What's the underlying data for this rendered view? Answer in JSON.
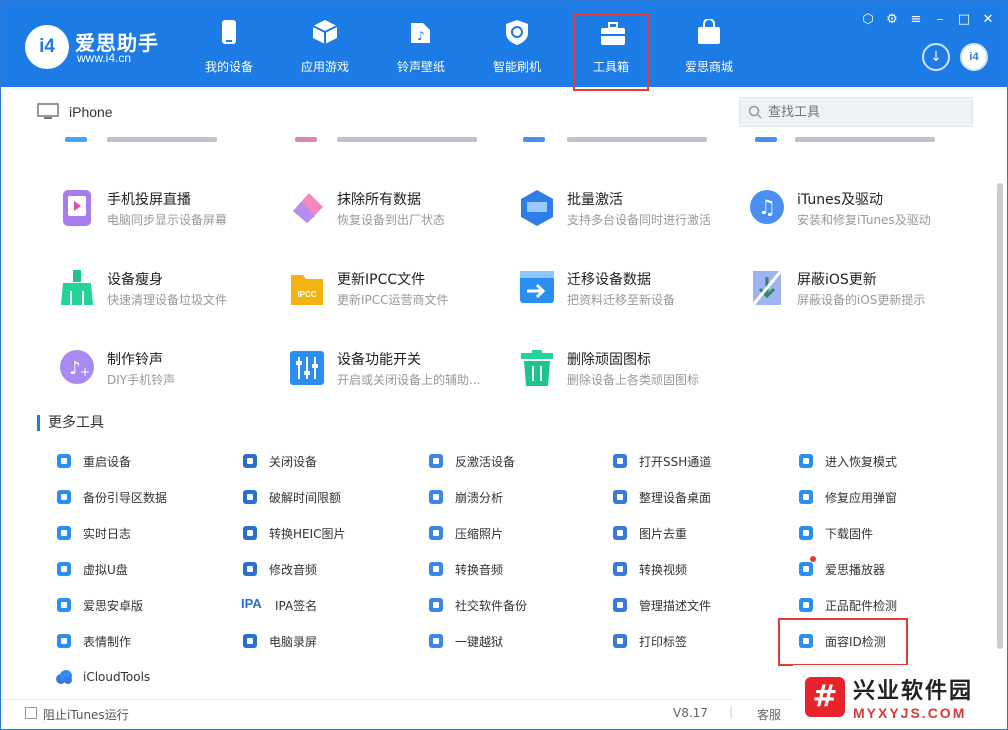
{
  "app": {
    "logo_text": "i4",
    "brand": "爱思助手",
    "url": "www.i4.cn"
  },
  "nav": [
    {
      "label": "我的设备",
      "icon": "phone-icon"
    },
    {
      "label": "应用游戏",
      "icon": "cube-icon"
    },
    {
      "label": "铃声壁纸",
      "icon": "music-file-icon"
    },
    {
      "label": "智能刷机",
      "icon": "refresh-shield-icon"
    },
    {
      "label": "工具箱",
      "icon": "toolbox-icon",
      "active": true
    },
    {
      "label": "爱思商城",
      "icon": "shopping-bag-icon"
    }
  ],
  "device": {
    "name": "iPhone"
  },
  "search": {
    "placeholder": "查找工具"
  },
  "tools": [
    {
      "title": "手机投屏直播",
      "desc": "电脑同步显示设备屏幕"
    },
    {
      "title": "抹除所有数据",
      "desc": "恢复设备到出厂状态"
    },
    {
      "title": "批量激活",
      "desc": "支持多台设备同时进行激活"
    },
    {
      "title": "iTunes及驱动",
      "desc": "安装和修复iTunes及驱动"
    },
    {
      "title": "设备瘦身",
      "desc": "快速清理设备垃圾文件"
    },
    {
      "title": "更新IPCC文件",
      "desc": "更新IPCC运营商文件",
      "badge": "IPCC"
    },
    {
      "title": "迁移设备数据",
      "desc": "把资料迁移至新设备"
    },
    {
      "title": "屏蔽iOS更新",
      "desc": "屏蔽设备的iOS更新提示"
    },
    {
      "title": "制作铃声",
      "desc": "DIY手机铃声"
    },
    {
      "title": "设备功能开关",
      "desc": "开启或关闭设备上的辅助..."
    },
    {
      "title": "删除顽固图标",
      "desc": "删除设备上各类顽固图标"
    }
  ],
  "more_title": "更多工具",
  "more": [
    [
      "重启设备",
      "关闭设备",
      "反激活设备",
      "打开SSH通道",
      "进入恢复模式"
    ],
    [
      "备份引导区数据",
      "破解时间限额",
      "崩溃分析",
      "整理设备桌面",
      "修复应用弹窗"
    ],
    [
      "实时日志",
      "转换HEIC图片",
      "压缩照片",
      "图片去重",
      "下载固件"
    ],
    [
      "虚拟U盘",
      "修改音频",
      "转换音频",
      "转换视频",
      "爱思播放器"
    ],
    [
      "爱思安卓版",
      "IPA签名",
      "社交软件备份",
      "管理描述文件",
      "正品配件检测"
    ],
    [
      "表情制作",
      "电脑录屏",
      "一键越狱",
      "打印标签",
      "面容ID检测"
    ],
    [
      "iCloudTools"
    ]
  ],
  "ipa_label": "IPA",
  "footer": {
    "itunes_label": "阻止iTunes运行",
    "version": "V8.17",
    "separator": "|",
    "support": "客服"
  },
  "watermark": {
    "logo": "#",
    "title": "兴业软件园",
    "site": "MYXYJS.COM"
  },
  "colors": {
    "header": "#1c7be4",
    "highlight": "#e53935"
  }
}
